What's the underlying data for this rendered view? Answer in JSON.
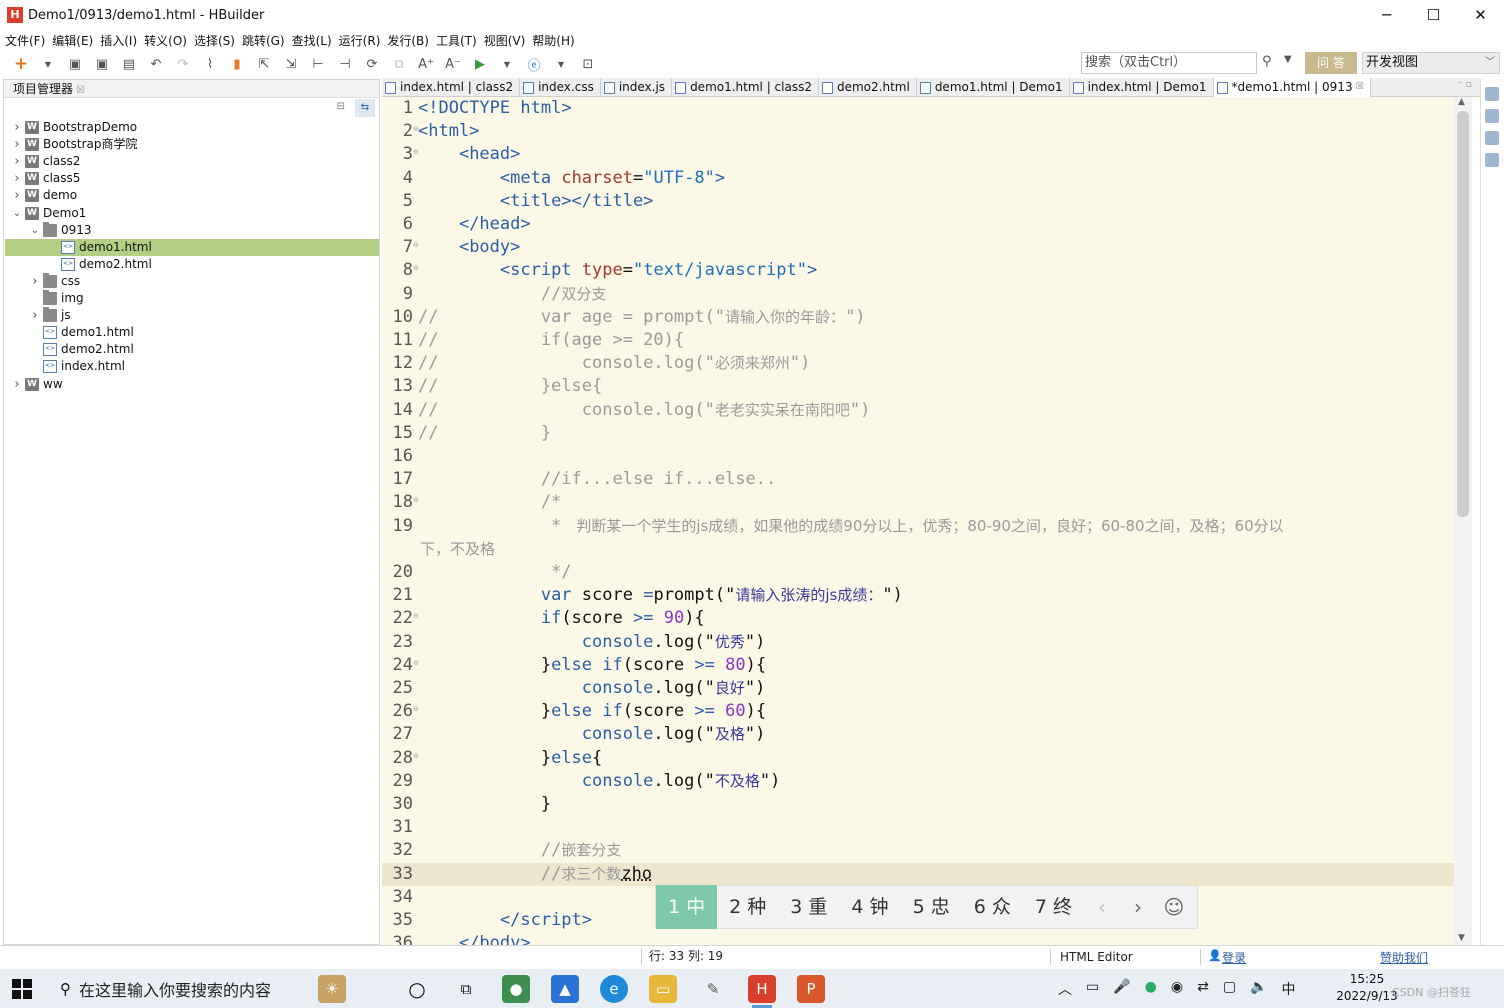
{
  "window": {
    "title": "Demo1/0913/demo1.html  -  HBuilder",
    "logo": "H",
    "controls": [
      "─",
      "☐",
      "✕"
    ]
  },
  "menu": [
    "文件(F)",
    "编辑(E)",
    "插入(I)",
    "转义(O)",
    "选择(S)",
    "跳转(G)",
    "查找(L)",
    "运行(R)",
    "发行(B)",
    "工具(T)",
    "视图(V)",
    "帮助(H)"
  ],
  "toolbar": {
    "search_placeholder": "搜索（双击Ctrl）",
    "qa_label": "问 答",
    "view_selector": "开发视图"
  },
  "project_panel": {
    "title": "项目管理器",
    "tree": [
      {
        "label": "BootstrapDemo",
        "type": "project",
        "level": 0,
        "expanded": false
      },
      {
        "label": "Bootstrap商学院",
        "type": "project",
        "level": 0,
        "expanded": false
      },
      {
        "label": "class2",
        "type": "project",
        "level": 0,
        "expanded": false
      },
      {
        "label": "class5",
        "type": "project",
        "level": 0,
        "expanded": false
      },
      {
        "label": "demo",
        "type": "project",
        "level": 0,
        "expanded": false
      },
      {
        "label": "Demo1",
        "type": "project",
        "level": 0,
        "expanded": true
      },
      {
        "label": "0913",
        "type": "folder",
        "level": 1,
        "expanded": true
      },
      {
        "label": "demo1.html",
        "type": "file",
        "level": 2,
        "selected": true
      },
      {
        "label": "demo2.html",
        "type": "file",
        "level": 2
      },
      {
        "label": "css",
        "type": "folder",
        "level": 1,
        "expanded": false
      },
      {
        "label": "img",
        "type": "folder",
        "level": 1,
        "leaf": true
      },
      {
        "label": "js",
        "type": "folder",
        "level": 1,
        "expanded": false
      },
      {
        "label": "demo1.html",
        "type": "file",
        "level": 1
      },
      {
        "label": "demo2.html",
        "type": "file",
        "level": 1
      },
      {
        "label": "index.html",
        "type": "file",
        "level": 1
      },
      {
        "label": "ww",
        "type": "project",
        "level": 0,
        "expanded": false
      }
    ]
  },
  "tabs": [
    {
      "label": "index.html | class2"
    },
    {
      "label": "index.css"
    },
    {
      "label": "index.js"
    },
    {
      "label": "demo1.html | class2"
    },
    {
      "label": "demo2.html"
    },
    {
      "label": "demo1.html | Demo1"
    },
    {
      "label": "index.html | Demo1"
    },
    {
      "label": "*demo1.html | 0913",
      "active": true
    }
  ],
  "editor": {
    "lines": [
      {
        "n": "1",
        "html": "<span class='t-tag'>&lt;!DOCTYPE</span> <span class='t-tag'>html</span><span class='t-tag'>&gt;</span>"
      },
      {
        "n": "2",
        "fold": true,
        "html": "<span class='t-tag'>&lt;html&gt;</span>"
      },
      {
        "n": "3",
        "fold": true,
        "html": "    <span class='t-tag'>&lt;head&gt;</span>"
      },
      {
        "n": "4",
        "html": "        <span class='t-tag'>&lt;meta</span> <span class='t-attr'>charset</span>=<span class='t-str'>\"UTF-8\"</span><span class='t-tag'>&gt;</span>"
      },
      {
        "n": "5",
        "html": "        <span class='t-tag'>&lt;title&gt;&lt;/title&gt;</span>"
      },
      {
        "n": "6",
        "html": "    <span class='t-tag'>&lt;/head&gt;</span>"
      },
      {
        "n": "7",
        "fold": true,
        "html": "    <span class='t-tag'>&lt;body&gt;</span>"
      },
      {
        "n": "8",
        "fold": true,
        "html": "        <span class='t-tag'>&lt;script</span> <span class='t-attr'>type</span>=<span class='t-str'>\"text/javascript\"</span><span class='t-tag'>&gt;</span>"
      },
      {
        "n": "9",
        "html": "            <span class='t-cmt'>//<span class='cmt-cn'>双分支</span></span>"
      },
      {
        "n": "10",
        "html": "<span class='t-cmt'>//          var age = prompt(\"<span class='cmt-cn'>请输入你的年龄：</span>\")</span>"
      },
      {
        "n": "11",
        "html": "<span class='t-cmt'>//          if(age &gt;= 20){</span>"
      },
      {
        "n": "12",
        "html": "<span class='t-cmt'>//              console.log(\"<span class='cmt-cn'>必须来郑州</span>\")</span>"
      },
      {
        "n": "13",
        "html": "<span class='t-cmt'>//          }else{</span>"
      },
      {
        "n": "14",
        "html": "<span class='t-cmt'>//              console.log(\"<span class='cmt-cn'>老老实实呆在南阳吧</span>\")</span>"
      },
      {
        "n": "15",
        "html": "<span class='t-cmt'>//          }</span>"
      },
      {
        "n": "16",
        "html": ""
      },
      {
        "n": "17",
        "html": "            <span class='t-cmt'>//if...else if...else..</span>"
      },
      {
        "n": "18",
        "fold": true,
        "html": "            <span class='t-cmt'>/*</span>"
      },
      {
        "n": "19",
        "html": "             <span class='t-cmt'>* <span class='cmt-cn'> 判断某一个学生的js成绩，如果他的成绩90分以上，优秀；80-90之间，良好；60-80之间，及格；60分以</span></span>"
      },
      {
        "n": "",
        "wrap": true,
        "html": "下，不及格"
      },
      {
        "n": "20",
        "html": "             <span class='t-cmt'>*/</span>"
      },
      {
        "n": "21",
        "html": "            <span class='t-kw'>var</span> score <span class='t-op'>=</span>prompt(\"<span class='cmt-cn' style='color:#3a3a9a'>请输入张涛的js成绩：</span>\")"
      },
      {
        "n": "22",
        "fold": true,
        "html": "            <span class='t-kw'>if</span>(score <span class='t-op'>&gt;=</span> <span class='t-num'>90</span>){"
      },
      {
        "n": "23",
        "html": "                <span class='t-kw'>console</span>.log(\"<span class='cmt-cn' style='color:#3a3a9a'>优秀</span>\")"
      },
      {
        "n": "24",
        "fold": true,
        "html": "            }<span class='t-kw'>else</span> <span class='t-kw'>if</span>(score <span class='t-op'>&gt;=</span> <span class='t-num'>80</span>){"
      },
      {
        "n": "25",
        "html": "                <span class='t-kw'>console</span>.log(\"<span class='cmt-cn' style='color:#3a3a9a'>良好</span>\")"
      },
      {
        "n": "26",
        "fold": true,
        "html": "            }<span class='t-kw'>else</span> <span class='t-kw'>if</span>(score <span class='t-op'>&gt;=</span> <span class='t-num'>60</span>){"
      },
      {
        "n": "27",
        "html": "                <span class='t-kw'>console</span>.log(\"<span class='cmt-cn' style='color:#3a3a9a'>及格</span>\")"
      },
      {
        "n": "28",
        "fold": true,
        "html": "            }<span class='t-kw'>else</span>{"
      },
      {
        "n": "29",
        "html": "                <span class='t-kw'>console</span>.log(\"<span class='cmt-cn' style='color:#3a3a9a'>不及格</span>\")"
      },
      {
        "n": "30",
        "html": "            }"
      },
      {
        "n": "31",
        "html": ""
      },
      {
        "n": "32",
        "html": "            <span class='t-cmt'>//<span class='cmt-cn'>嵌套分支</span></span>"
      },
      {
        "n": "33",
        "current": true,
        "html": "            <span class='t-cmt'>//<span class='cmt-cn'>求三个数</span></span><span style='text-decoration:underline dotted'>zho</span>"
      },
      {
        "n": "34",
        "html": ""
      },
      {
        "n": "35",
        "html": "        <span class='t-tag'>&lt;/script&gt;</span>"
      },
      {
        "n": "36",
        "html": "    <span class='t-tag'>&lt;/body&gt;</span>"
      }
    ]
  },
  "ime": {
    "candidates": [
      "1 中",
      "2 种",
      "3 重",
      "4 钟",
      "5 忠",
      "6 众",
      "7 终"
    ],
    "prev": "‹",
    "next": "›",
    "emoji": "☺"
  },
  "status": {
    "position": "行: 33 列: 19",
    "mode": "HTML Editor",
    "login": "登录",
    "sponsor": "赞助我们"
  },
  "taskbar": {
    "search_text": "在这里输入你要搜索的内容",
    "time": "15:25",
    "date": "2022/9/13",
    "ime_indicator": "中",
    "watermark": "CSDN @扫苍狂"
  }
}
